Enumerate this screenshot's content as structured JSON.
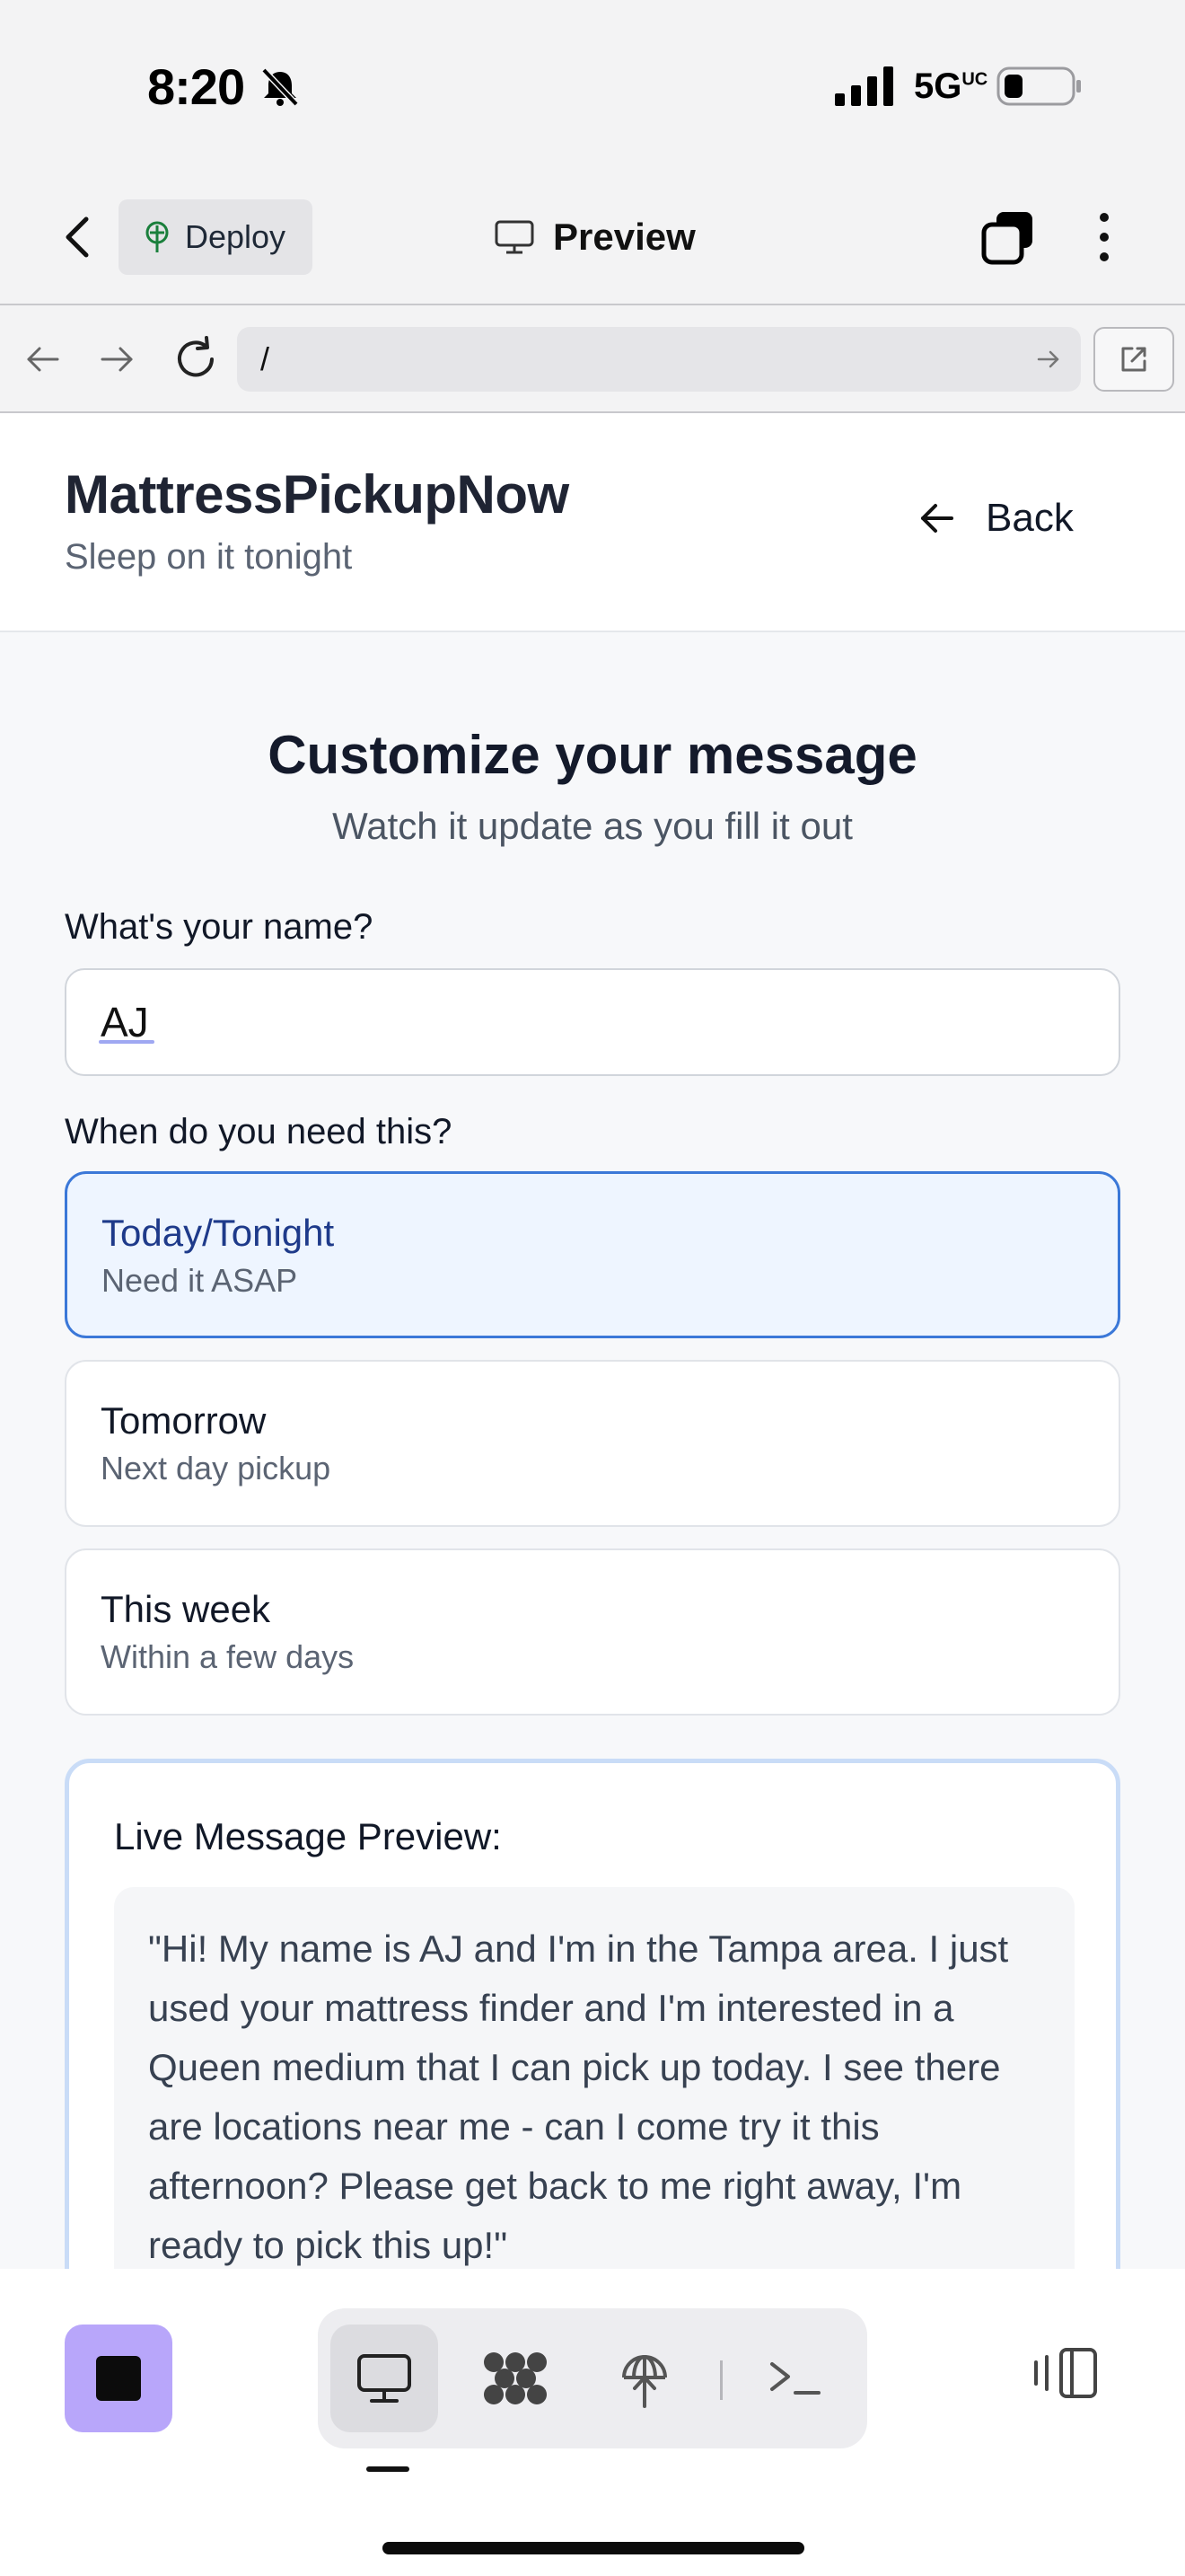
{
  "status_bar": {
    "time": "8:20",
    "network": "5G",
    "network_sup": "UC"
  },
  "app_header": {
    "deploy_label": "Deploy",
    "preview_label": "Preview"
  },
  "browser": {
    "url": "/"
  },
  "site": {
    "brand": "MattressPickupNow",
    "tagline": "Sleep on it tonight",
    "back_label": "Back"
  },
  "form": {
    "heading": "Customize your message",
    "subheading": "Watch it update as you fill it out",
    "name_label": "What's your name?",
    "name_value": "AJ",
    "when_label": "When do you need this?",
    "options": [
      {
        "title": "Today/Tonight",
        "subtitle": "Need it ASAP",
        "selected": true
      },
      {
        "title": "Tomorrow",
        "subtitle": "Next day pickup",
        "selected": false
      },
      {
        "title": "This week",
        "subtitle": "Within a few days",
        "selected": false
      }
    ],
    "preview_label": "Live Message Preview:",
    "preview_message": "\"Hi! My name is AJ and I'm in the Tampa area. I just used your mattress finder and I'm interested in a Queen medium that I can pick up today. I see there are locations near me - can I come try it this afternoon? Please get back to me right away, I'm ready to pick this up!\""
  },
  "toolbar": {
    "accent": "#b8a6fa",
    "items": [
      "desktop-icon",
      "apps-icon",
      "deploy-icon",
      "terminal-icon"
    ]
  }
}
